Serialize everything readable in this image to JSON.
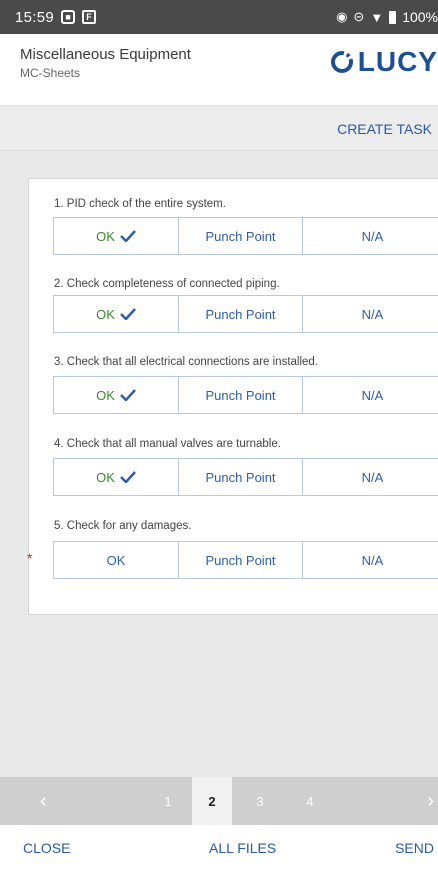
{
  "status_bar": {
    "time": "15:59",
    "notification_icons": [
      "camera-icon",
      "f-icon"
    ],
    "battery": "100%"
  },
  "header": {
    "title": "Miscellaneous Equipment",
    "subtitle": "MC-Sheets",
    "logo_text": "LUCY",
    "brand_color": "#1d4f96"
  },
  "actions": {
    "create_task": "CREATE TASK"
  },
  "checklist": {
    "option_ok": "OK",
    "option_punch": "Punch Point",
    "option_na": "N/A",
    "items": [
      {
        "label": "1. PID check of the entire system.",
        "selected": "OK"
      },
      {
        "label": "2. Check completeness of connected piping.",
        "selected": "OK"
      },
      {
        "label": "3. Check that all electrical connections are installed.",
        "selected": "OK"
      },
      {
        "label": "4. Check that all manual valves are turnable.",
        "selected": "OK"
      },
      {
        "label": "5. Check for any damages.",
        "selected": "",
        "required_marker": "*"
      }
    ],
    "ok_color": "#3b8a2e",
    "required_color": "#d12b2b"
  },
  "pager": {
    "pages": [
      "1",
      "2",
      "3",
      "4"
    ],
    "current_page": "2"
  },
  "footer": {
    "close": "CLOSE",
    "all_files": "ALL FILES",
    "send": "SEND"
  }
}
